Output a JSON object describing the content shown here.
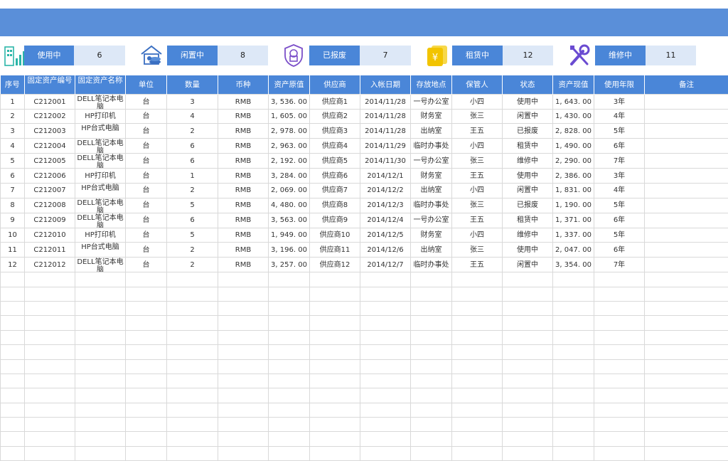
{
  "stats": [
    {
      "label": "使用中",
      "value": "6",
      "icon": "building-chart-icon",
      "color": "#2bb5a8"
    },
    {
      "label": "闲置中",
      "value": "8",
      "icon": "house-coins-icon",
      "color": "#3a6fc2"
    },
    {
      "label": "已报废",
      "value": "7",
      "icon": "shield-lock-icon",
      "color": "#7b4fc9"
    },
    {
      "label": "租赁中",
      "value": "12",
      "icon": "yen-cards-icon",
      "color": "#f2c400"
    },
    {
      "label": "维修中",
      "value": "11",
      "icon": "tools-icon",
      "color": "#6a4bd1"
    }
  ],
  "table": {
    "headers": [
      "序号",
      "固定资产编号",
      "固定资产名称",
      "单位",
      "数量",
      "币种",
      "资产原值",
      "供应商",
      "入帐日期",
      "存放地点",
      "保管人",
      "状态",
      "资产现值",
      "使用年限",
      "备注"
    ],
    "rows": [
      [
        "1",
        "C212001",
        "DELL笔记本电脑",
        "台",
        "3",
        "RMB",
        "3, 536. 00",
        "供应商1",
        "2014/11/28",
        "一号办公室",
        "小四",
        "使用中",
        "1, 643. 00",
        "3年",
        ""
      ],
      [
        "2",
        "C212002",
        "HP打印机",
        "台",
        "4",
        "RMB",
        "1, 605. 00",
        "供应商2",
        "2014/11/28",
        "财务室",
        "张三",
        "闲置中",
        "1, 430. 00",
        "4年",
        ""
      ],
      [
        "3",
        "C212003",
        "HP台式电脑",
        "台",
        "2",
        "RMB",
        "2, 978. 00",
        "供应商3",
        "2014/11/28",
        "出纳室",
        "王五",
        "已报废",
        "2, 828. 00",
        "5年",
        ""
      ],
      [
        "4",
        "C212004",
        "DELL笔记本电脑",
        "台",
        "6",
        "RMB",
        "2, 963. 00",
        "供应商4",
        "2014/11/29",
        "临时办事处",
        "小四",
        "租赁中",
        "1, 490. 00",
        "6年",
        ""
      ],
      [
        "5",
        "C212005",
        "DELL笔记本电脑",
        "台",
        "6",
        "RMB",
        "2, 192. 00",
        "供应商5",
        "2014/11/30",
        "一号办公室",
        "张三",
        "维修中",
        "2, 290. 00",
        "7年",
        ""
      ],
      [
        "6",
        "C212006",
        "HP打印机",
        "台",
        "1",
        "RMB",
        "3, 284. 00",
        "供应商6",
        "2014/12/1",
        "财务室",
        "王五",
        "使用中",
        "2, 386. 00",
        "3年",
        ""
      ],
      [
        "7",
        "C212007",
        "HP台式电脑",
        "台",
        "2",
        "RMB",
        "2, 069. 00",
        "供应商7",
        "2014/12/2",
        "出纳室",
        "小四",
        "闲置中",
        "1, 831. 00",
        "4年",
        ""
      ],
      [
        "8",
        "C212008",
        "DELL笔记本电脑",
        "台",
        "5",
        "RMB",
        "4, 480. 00",
        "供应商8",
        "2014/12/3",
        "临时办事处",
        "张三",
        "已报废",
        "1, 190. 00",
        "5年",
        ""
      ],
      [
        "9",
        "C212009",
        "DELL笔记本电脑",
        "台",
        "6",
        "RMB",
        "3, 563. 00",
        "供应商9",
        "2014/12/4",
        "一号办公室",
        "王五",
        "租赁中",
        "1, 371. 00",
        "6年",
        ""
      ],
      [
        "10",
        "C212010",
        "HP打印机",
        "台",
        "5",
        "RMB",
        "1, 949. 00",
        "供应商10",
        "2014/12/5",
        "财务室",
        "小四",
        "维修中",
        "1, 337. 00",
        "5年",
        ""
      ],
      [
        "11",
        "C212011",
        "HP台式电脑",
        "台",
        "2",
        "RMB",
        "3, 196. 00",
        "供应商11",
        "2014/12/6",
        "出纳室",
        "张三",
        "使用中",
        "2, 047. 00",
        "6年",
        ""
      ],
      [
        "12",
        "C212012",
        "DELL笔记本电脑",
        "台",
        "2",
        "RMB",
        "3, 257. 00",
        "供应商12",
        "2014/12/7",
        "临时办事处",
        "王五",
        "闲置中",
        "3, 354. 00",
        "7年",
        ""
      ]
    ],
    "empty_rows": 13
  }
}
